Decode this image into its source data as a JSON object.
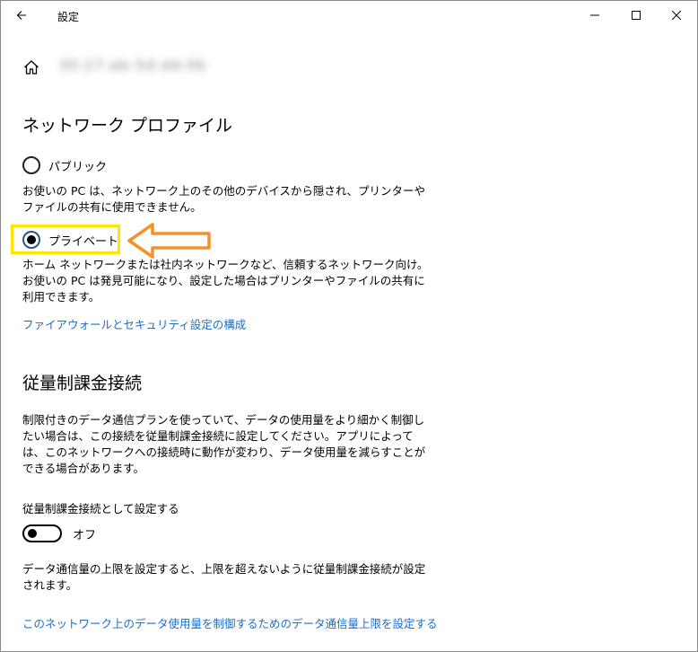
{
  "window": {
    "title": "設定",
    "network_name": "30:27:ab:5d:dd:0b"
  },
  "sections": {
    "profile_title": "ネットワーク プロファイル",
    "metered_title": "従量制課金接続"
  },
  "profile": {
    "public_label": "パブリック",
    "public_desc": "お使いの PC は、ネットワーク上のその他のデバイスから隠され、プリンターやファイルの共有に使用できません。",
    "private_label": "プライベート",
    "private_desc": "ホーム ネットワークまたは社内ネットワークなど、信頼するネットワーク向け。お使いの PC は発見可能になり、設定した場合はプリンターやファイルの共有に利用できます。",
    "selected": "private",
    "firewall_link": "ファイアウォールとセキュリティ設定の構成"
  },
  "metered": {
    "desc": "制限付きのデータ通信プランを使っていて、データの使用量をより細かく制御したい場合は、この接続を従量制課金接続に設定してください。アプリによっては、このネットワークへの接続時に動作が変わり、データ使用量を減らすことができる場合があります。",
    "setting_label": "従量制課金接続として設定する",
    "toggle_state": "オフ",
    "limit_desc": "データ通信量の上限を設定すると、上限を超えないように従量制課金接続が設定されます。",
    "limit_link": "このネットワーク上のデータ使用量を制御するためのデータ通信量上限を設定する"
  },
  "colors": {
    "link": "#1a6ec7",
    "highlight": "#ffe600",
    "arrow": "#f5902a"
  }
}
